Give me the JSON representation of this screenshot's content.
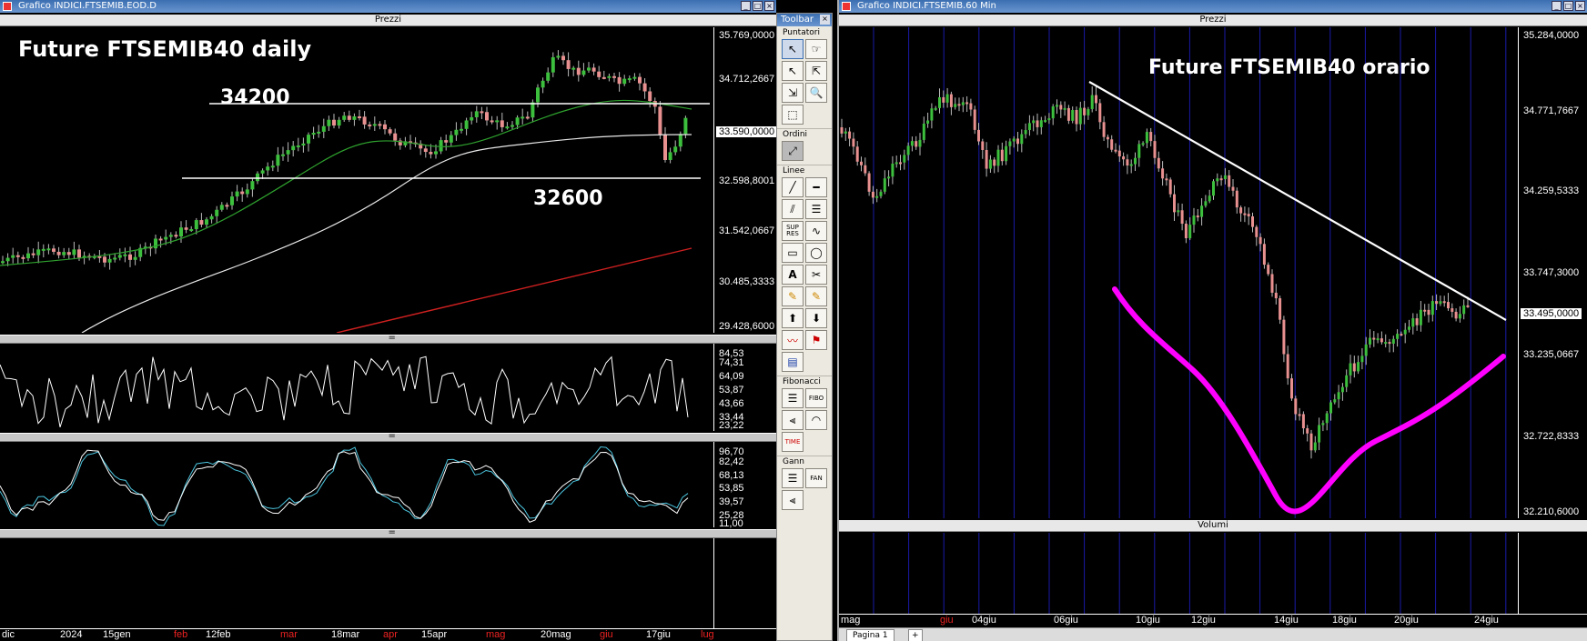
{
  "left_window": {
    "title": "Grafico INDICI.FTSEMIB.EOD.D",
    "pane_header": "Prezzi",
    "annotation_title": "Future FTSEMIB40 daily",
    "annotation_level_top": "34200",
    "annotation_level_bottom": "32600",
    "price_scale": [
      "35.769,0000",
      "34.712,2667",
      "32.598,8001",
      "31.542,0667",
      "30.485,3333",
      "29.428,6000"
    ],
    "last_price": "33.590,0000",
    "rsi_scale": [
      "84,53",
      "74,31",
      "64,09",
      "53,87",
      "43,66",
      "33,44",
      "23,22"
    ],
    "stoch_scale": [
      "96,70",
      "82,42",
      "68,13",
      "53,85",
      "39,57",
      "25,28",
      "11,00"
    ],
    "dates": [
      {
        "label": "dic",
        "red": false
      },
      {
        "label": "2024",
        "red": false
      },
      {
        "label": "15gen",
        "red": false
      },
      {
        "label": "feb",
        "red": true
      },
      {
        "label": "12feb",
        "red": false
      },
      {
        "label": "mar",
        "red": true
      },
      {
        "label": "18mar",
        "red": false
      },
      {
        "label": "apr",
        "red": true
      },
      {
        "label": "15apr",
        "red": false
      },
      {
        "label": "mag",
        "red": true
      },
      {
        "label": "20mag",
        "red": false
      },
      {
        "label": "giu",
        "red": true
      },
      {
        "label": "17giu",
        "red": false
      },
      {
        "label": "lug",
        "red": true
      }
    ]
  },
  "toolbar": {
    "title": "Toolbar",
    "groups": {
      "pointers": "Puntatori",
      "orders": "Ordini",
      "lines": "Linee",
      "fibonacci": "Fibonacci",
      "gann": "Gann"
    },
    "icons": {
      "sup_res": "SUP RES",
      "fibo": "FIBO",
      "time": "TIME",
      "gann_fan": "FAN"
    }
  },
  "right_window": {
    "title": "Grafico INDICI.FTSEMIB.60 Min",
    "pane_header": "Prezzi",
    "volume_header": "Volumi",
    "annotation_title": "Future FTSEMIB40 orario",
    "price_scale": [
      "35.284,0000",
      "34.771,7667",
      "34.259,5333",
      "33.747,3000",
      "33.235,0667",
      "32.722,8333",
      "32.210,6000"
    ],
    "last_price": "33.495,0000",
    "dates": [
      {
        "label": "mag",
        "red": false
      },
      {
        "label": "giu",
        "red": true
      },
      {
        "label": "04giu",
        "red": false
      },
      {
        "label": "06giu",
        "red": false
      },
      {
        "label": "10giu",
        "red": false
      },
      {
        "label": "12giu",
        "red": false
      },
      {
        "label": "14giu",
        "red": false
      },
      {
        "label": "18giu",
        "red": false
      },
      {
        "label": "20giu",
        "red": false
      },
      {
        "label": "24giu",
        "red": false
      }
    ],
    "page_tab": "Pagina 1"
  },
  "colors": {
    "candle_up": "#3cbf3c",
    "candle_down": "#e89090",
    "ma_short": "#2ea02e",
    "ma_long": "#e8e8e8",
    "ma_200": "#d02020",
    "stoch_k": "#ffffff",
    "stoch_d": "#4cc6e0",
    "hourly_grid": "#1a1aa8",
    "annotation_curve": "#ff00ff"
  }
}
